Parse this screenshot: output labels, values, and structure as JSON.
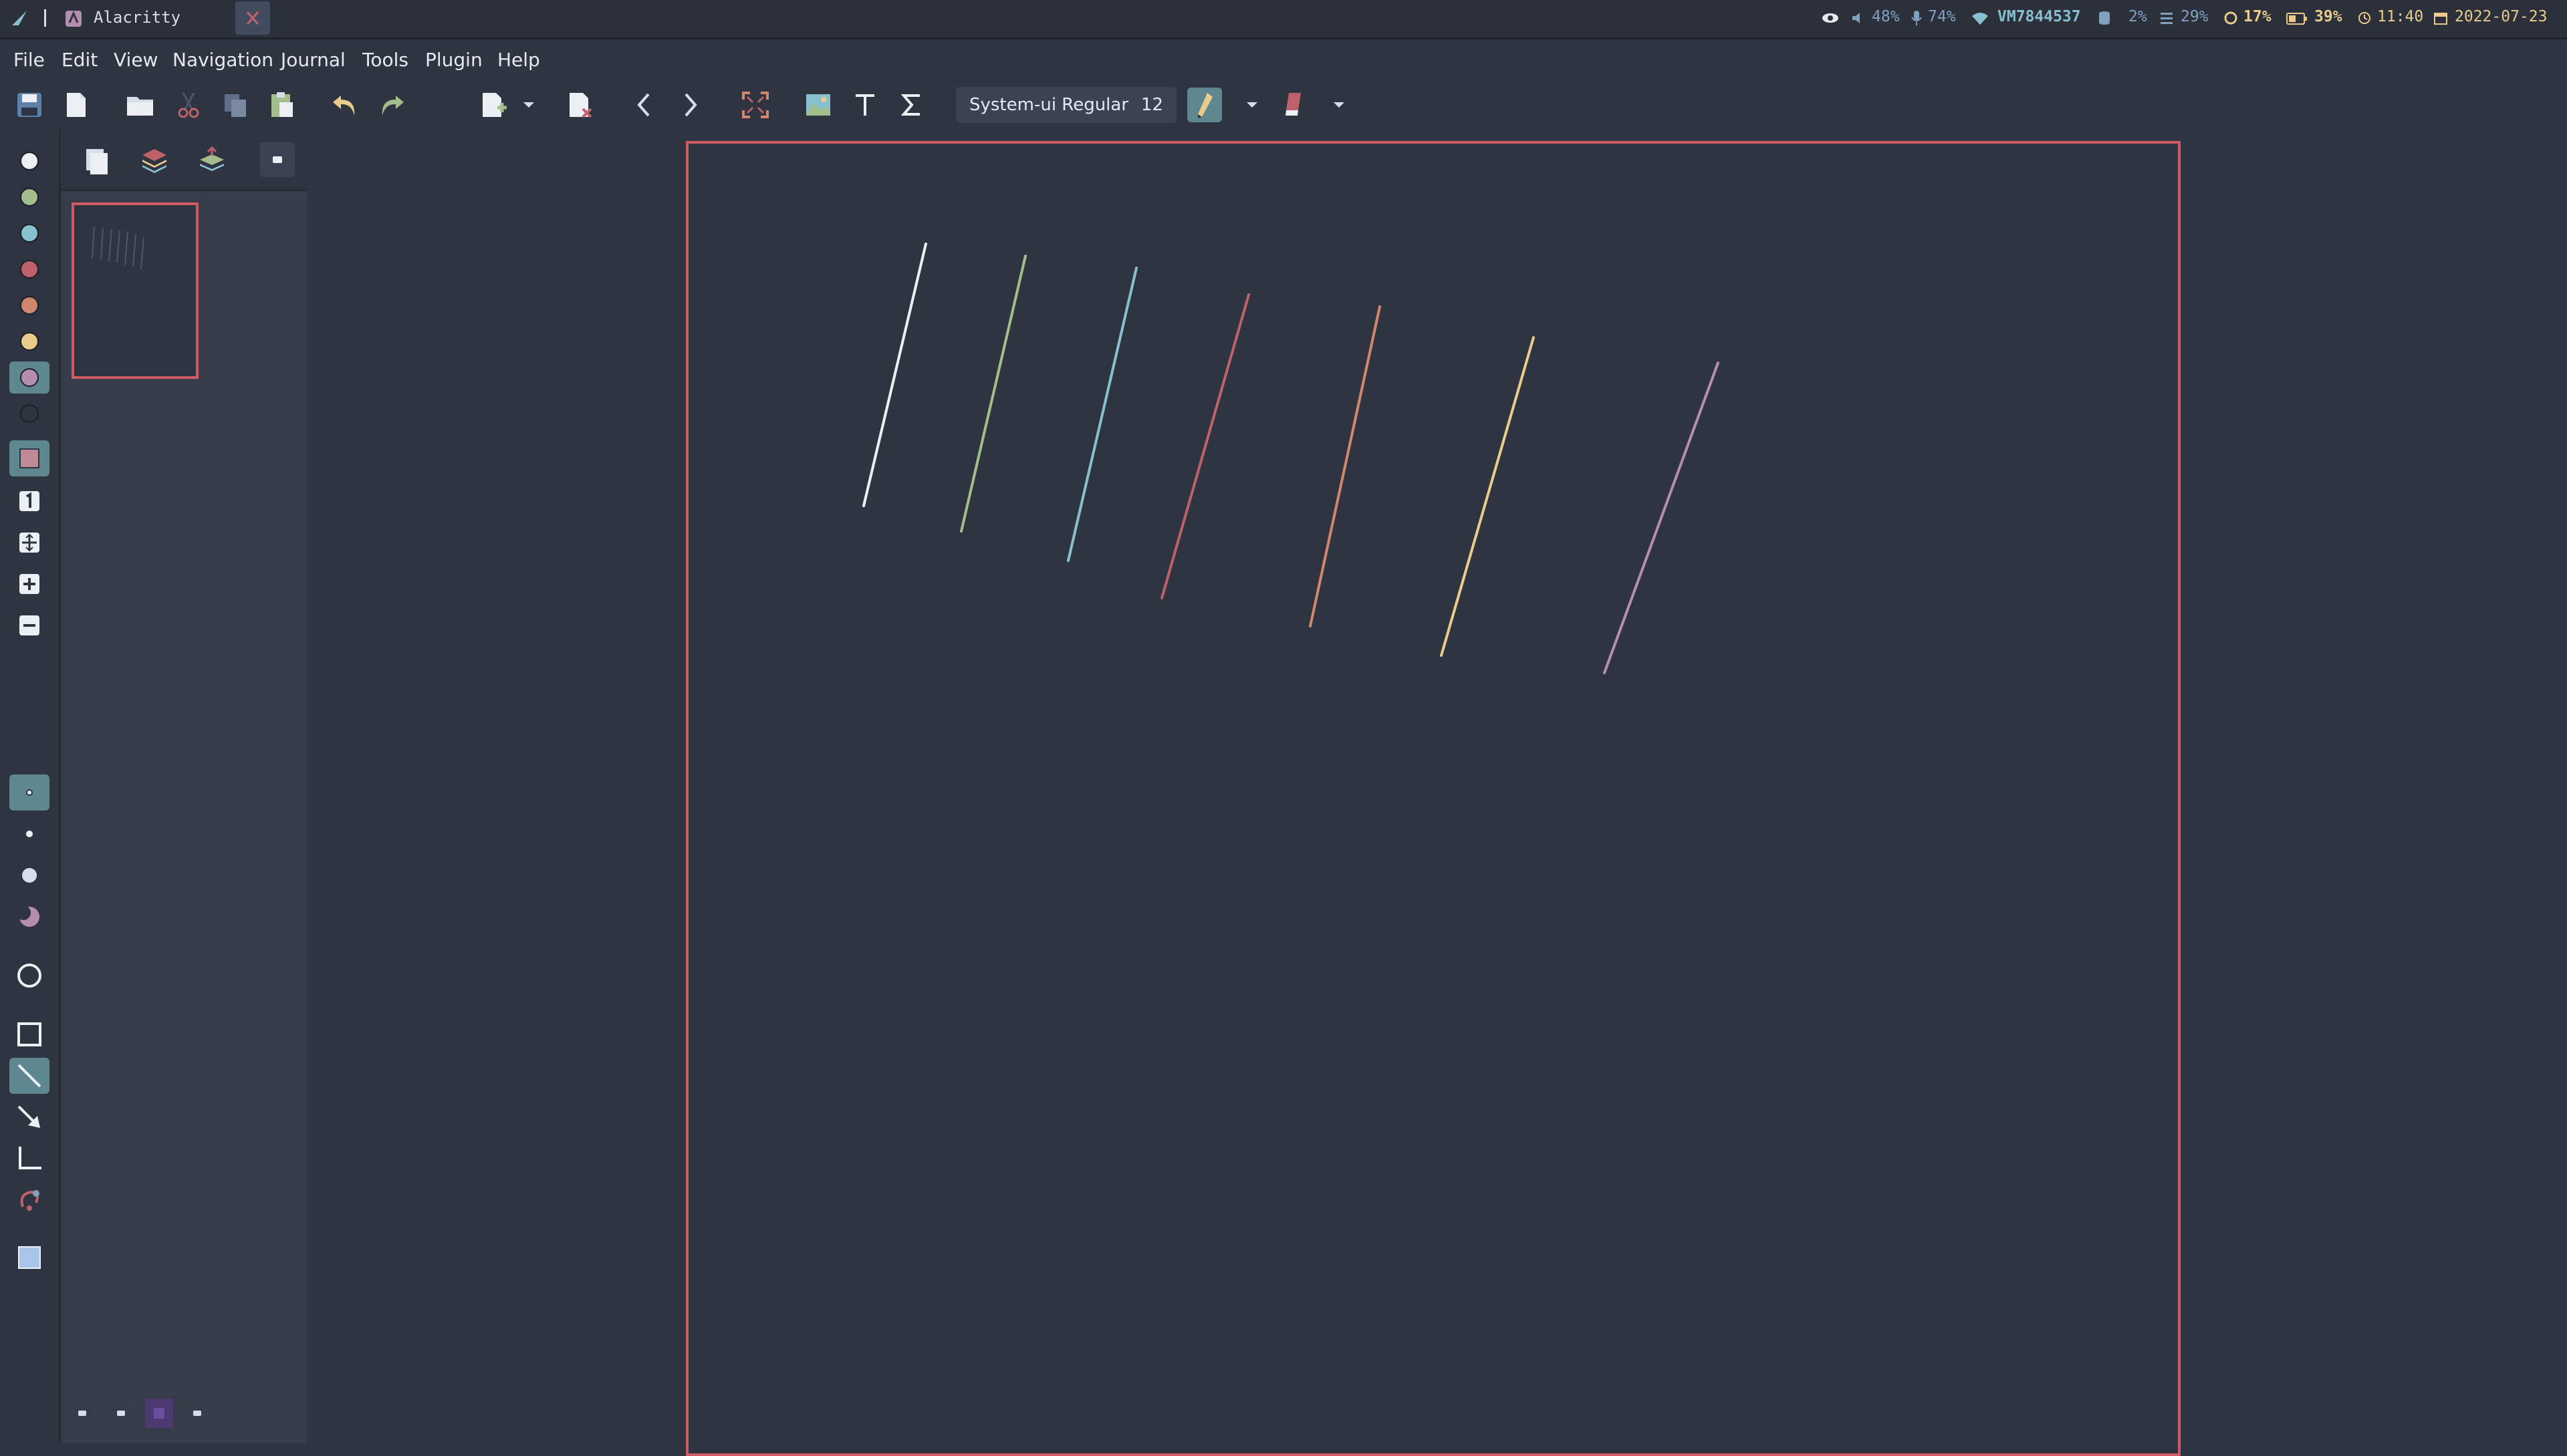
{
  "window": {
    "title": "Alacritty"
  },
  "tray": {
    "volume": "48%",
    "mic": "74%",
    "wifi": "VM7844537",
    "cpu": "2%",
    "mem": "29%",
    "swap": "17%",
    "battery": "39%",
    "time": "11:40",
    "date": "2022-07-23"
  },
  "menu": [
    "File",
    "Edit",
    "View",
    "Navigation",
    "Journal",
    "Tools",
    "Plugin",
    "Help"
  ],
  "font": {
    "name": "System-ui Regular",
    "size": "12"
  },
  "pen_colors": [
    "#eceff4",
    "#a3be8c",
    "#88c0d0",
    "#bf616a",
    "#d08770",
    "#ebcb8b",
    "#b48ead",
    "#2e3440"
  ],
  "strokes": [
    {
      "color": "#eceff4"
    },
    {
      "color": "#a3be8c"
    },
    {
      "color": "#88c0d0"
    },
    {
      "color": "#bf616a"
    },
    {
      "color": "#d08770"
    },
    {
      "color": "#ebcb8b"
    },
    {
      "color": "#b48ead"
    }
  ],
  "accent": "#d05a64"
}
